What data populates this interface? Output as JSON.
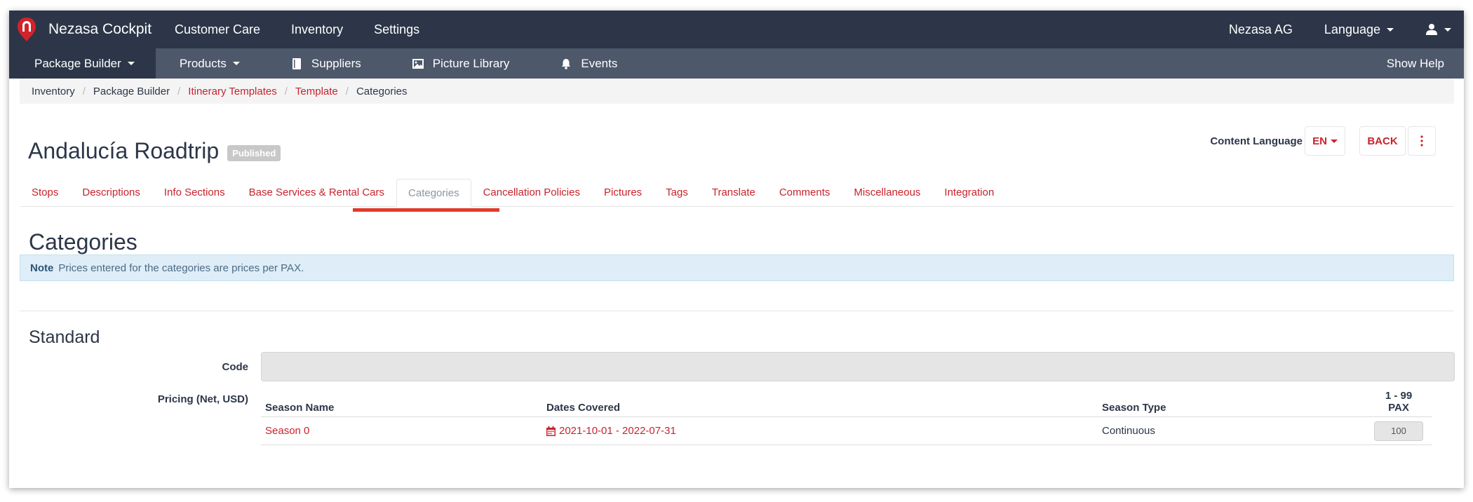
{
  "topbar": {
    "brand": "Nezasa Cockpit",
    "nav": [
      "Customer Care",
      "Inventory",
      "Settings"
    ],
    "company": "Nezasa AG",
    "language": "Language"
  },
  "subbar": {
    "package_builder": "Package Builder",
    "products": "Products",
    "suppliers": "Suppliers",
    "picture_library": "Picture Library",
    "events": "Events",
    "show_help": "Show Help"
  },
  "breadcrumb": [
    "Inventory",
    "Package Builder",
    "Itinerary Templates",
    "Template",
    "Categories"
  ],
  "page": {
    "title": "Andalucía Roadtrip",
    "status": "Published",
    "content_language_label": "Content Language",
    "content_language": "EN",
    "back_label": "BACK"
  },
  "tabs": [
    "Stops",
    "Descriptions",
    "Info Sections",
    "Base Services & Rental Cars",
    "Categories",
    "Cancellation Policies",
    "Pictures",
    "Tags",
    "Translate",
    "Comments",
    "Miscellaneous",
    "Integration"
  ],
  "section": {
    "title": "Categories",
    "note_label": "Note",
    "note_text": "Prices entered for the categories are prices per PAX."
  },
  "category": {
    "name": "Standard",
    "code_label": "Code",
    "code_value": "",
    "pricing_label": "Pricing (Net, USD)",
    "table": {
      "headers": {
        "season_name": "Season Name",
        "dates_covered": "Dates Covered",
        "season_type": "Season Type",
        "pax_range": "1 - 99",
        "pax_unit": "PAX"
      },
      "rows": [
        {
          "season": "Season 0",
          "dates": "2021-10-01 - 2022-07-31",
          "type": "Continuous",
          "price": "100"
        }
      ]
    }
  },
  "colors": {
    "navbar": "#2c3648",
    "subnav": "#4e586b",
    "accent": "#c8232c",
    "tab_indicator": "#e03a2b",
    "note_bg": "#deedf7"
  }
}
